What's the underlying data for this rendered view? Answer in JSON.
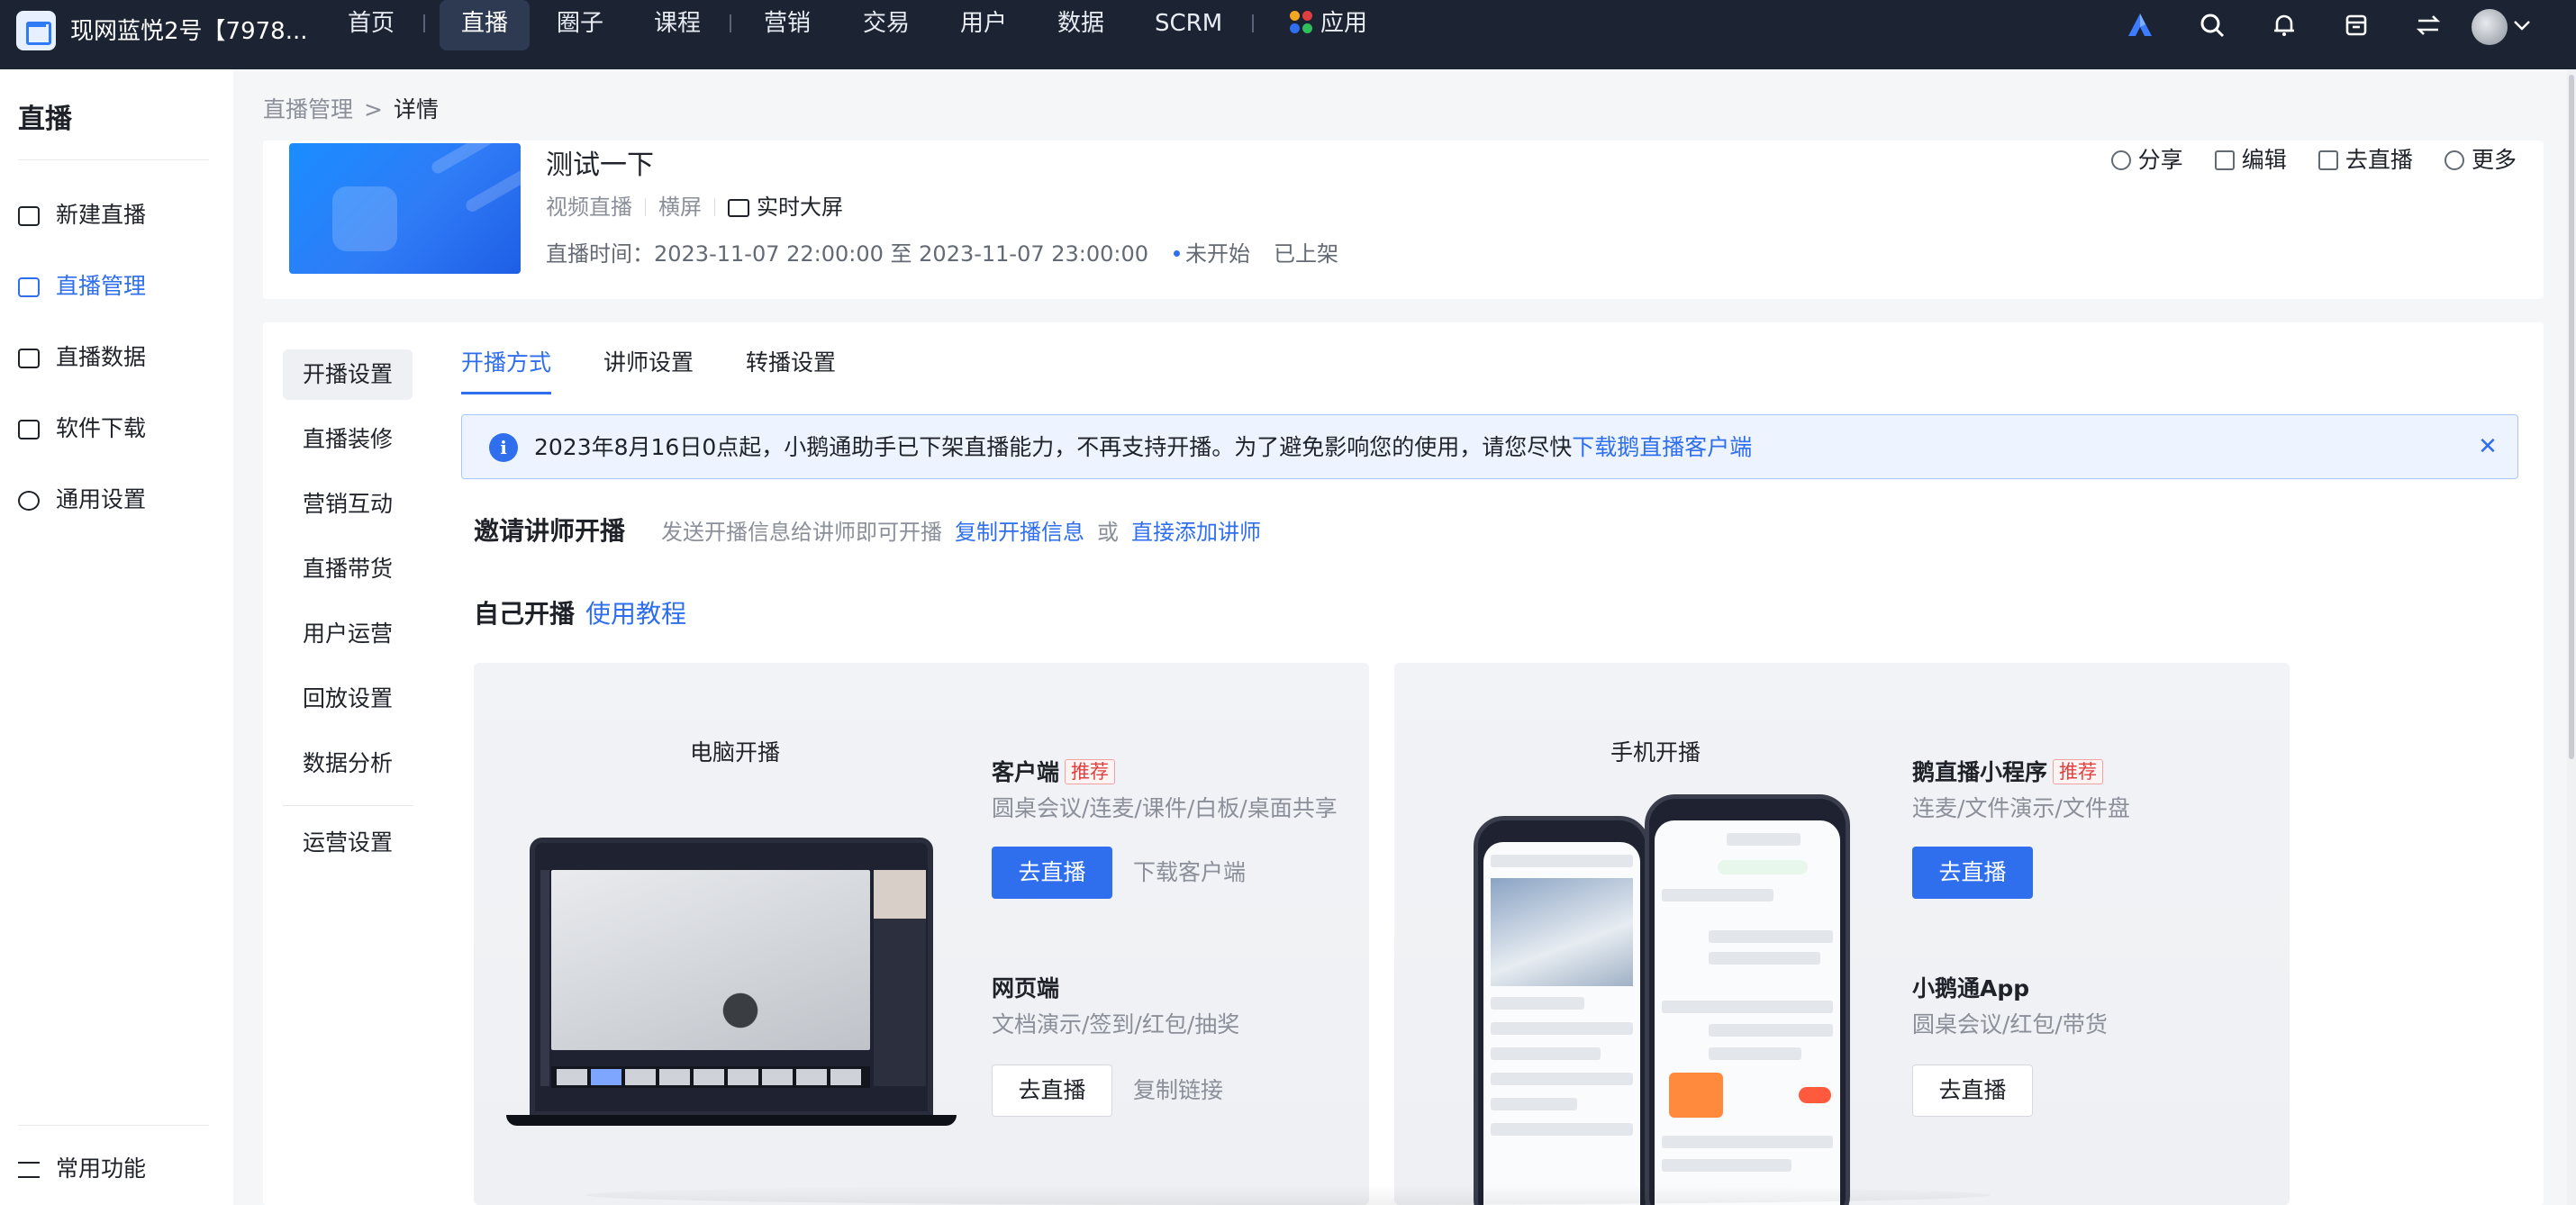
{
  "topbar": {
    "brand_name": "现网蓝悦2号【7978...",
    "nav": [
      "首页",
      "直播",
      "圈子",
      "课程",
      "营销",
      "交易",
      "用户",
      "数据",
      "SCRM",
      "应用"
    ],
    "active_nav": "直播"
  },
  "sidebar": {
    "title": "直播",
    "items": [
      "新建直播",
      "直播管理",
      "直播数据",
      "软件下载",
      "通用设置"
    ],
    "active": "直播管理",
    "footer": "常用功能"
  },
  "breadcrumb": {
    "parent": "直播管理",
    "separator": ">",
    "current": "详情"
  },
  "header": {
    "title": "测试一下",
    "type": "视频直播",
    "orientation": "横屏",
    "big_screen": "实时大屏",
    "time_label": "直播时间：",
    "time_range": "2023-11-07 22:00:00 至 2023-11-07 23:00:00",
    "status": "未开始",
    "shelf": "已上架",
    "actions": [
      "分享",
      "编辑",
      "去直播",
      "更多"
    ]
  },
  "subnav": {
    "items": [
      "开播设置",
      "直播装修",
      "营销互动",
      "直播带货",
      "用户运营",
      "回放设置",
      "数据分析"
    ],
    "extra": "运营设置",
    "active": "开播设置"
  },
  "tabs": {
    "items": [
      "开播方式",
      "讲师设置",
      "转播设置"
    ],
    "active": "开播方式"
  },
  "notice": {
    "text": "2023年8月16日0点起，小鹅通助手已下架直播能力，不再支持开播。为了避免影响您的使用，请您尽快",
    "link": "下载鹅直播客户端"
  },
  "invite": {
    "title": "邀请讲师开播",
    "hint": "发送开播信息给讲师即可开播",
    "copy_link": "复制开播信息",
    "or": "或",
    "add_link": "直接添加讲师"
  },
  "self_start": {
    "title": "自己开播",
    "tutorial": "使用教程"
  },
  "pc_panel": {
    "title": "电脑开播",
    "client": {
      "name": "客户端",
      "tag": "推荐",
      "desc": "圆桌会议/连麦/课件/白板/桌面共享",
      "btn": "去直播",
      "link": "下载客户端"
    },
    "web": {
      "name": "网页端",
      "desc": "文档演示/签到/红包/抽奖",
      "btn": "去直播",
      "link": "复制链接"
    }
  },
  "mobile_panel": {
    "title": "手机开播",
    "mini": {
      "name": "鹅直播小程序",
      "tag": "推荐",
      "desc": "连麦/文件演示/文件盘",
      "btn": "去直播"
    },
    "app": {
      "name": "小鹅通App",
      "desc": "圆桌会议/红包/带货",
      "btn": "去直播"
    }
  },
  "colors": {
    "accent": "#2f6fed",
    "topbar": "#1c2433",
    "tag_red": "#e03f3f"
  }
}
